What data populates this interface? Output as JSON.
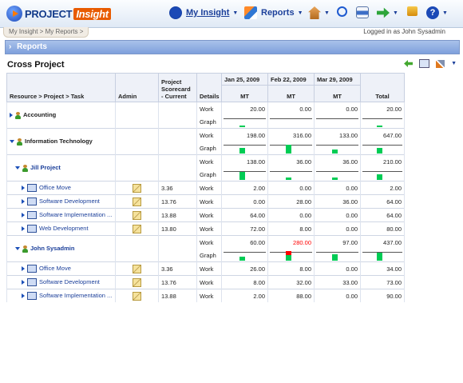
{
  "app": {
    "name_a": "PROJECT",
    "name_b": "Insight"
  },
  "toolbar": {
    "my_insight": "My Insight",
    "reports": "Reports"
  },
  "breadcrumb": "My Insight > My Reports >",
  "logged_in": "Logged in as John Sysadmin",
  "section": "Reports",
  "page_title": "Cross Project",
  "columns": {
    "resource": "Resource > Project > Task",
    "admin": "Admin",
    "scorecard": "Project Scorecard - Current",
    "details": "Details",
    "d1": "Jan 25, 2009",
    "d2": "Feb 22, 2009",
    "d3": "Mar 29, 2009",
    "mt": "MT",
    "total": "Total"
  },
  "rows": {
    "accounting": {
      "label": "Accounting",
      "work": [
        "20.00",
        "0.00",
        "0.00",
        "20.00"
      ],
      "graph": "Graph",
      "work_label": "Work"
    },
    "it": {
      "label": "Information Technology",
      "work": [
        "198.00",
        "316.00",
        "133.00",
        "647.00"
      ],
      "graph": "Graph",
      "work_label": "Work"
    },
    "jill": {
      "label": "Jill Project",
      "work": [
        "138.00",
        "36.00",
        "36.00",
        "210.00"
      ],
      "graph": "Graph",
      "work_label": "Work"
    },
    "t1": {
      "label": "Office Move",
      "score": "3.36",
      "work": [
        "2.00",
        "0.00",
        "0.00",
        "2.00"
      ],
      "work_label": "Work"
    },
    "t2": {
      "label": "Software Development",
      "score": "13.76",
      "work": [
        "0.00",
        "28.00",
        "36.00",
        "64.00"
      ],
      "work_label": "Work"
    },
    "t3": {
      "label": "Software Implementation ...",
      "score": "13.88",
      "work": [
        "64.00",
        "0.00",
        "0.00",
        "64.00"
      ],
      "work_label": "Work"
    },
    "t4": {
      "label": "Web Development",
      "score": "13.80",
      "work": [
        "72.00",
        "8.00",
        "0.00",
        "80.00"
      ],
      "work_label": "Work"
    },
    "john": {
      "label": "John Sysadmin",
      "work": [
        "60.00",
        "280.00",
        "97.00",
        "437.00"
      ],
      "graph": "Graph",
      "work_label": "Work"
    },
    "u1": {
      "label": "Office Move",
      "score": "3.36",
      "work": [
        "26.00",
        "8.00",
        "0.00",
        "34.00"
      ],
      "work_label": "Work"
    },
    "u2": {
      "label": "Software Development",
      "score": "13.76",
      "work": [
        "8.00",
        "32.00",
        "33.00",
        "73.00"
      ],
      "work_label": "Work"
    },
    "u3": {
      "label": "Software Implementation ...",
      "score": "13.88",
      "work": [
        "2.00",
        "88.00",
        "0.00",
        "90.00"
      ],
      "work_label": "Work"
    }
  },
  "graph_levels": {
    "accounting": [
      0.18,
      0,
      0,
      0.05
    ],
    "it": [
      0.6,
      0.95,
      0.4,
      0.55
    ],
    "jill": [
      0.85,
      0.25,
      0.25,
      0.55
    ],
    "john": [
      0.45,
      1.0,
      0.7,
      0.85
    ]
  },
  "colors": {
    "accent": "#1b3f9a",
    "bar": "#00cc55",
    "over": "#ff0000"
  }
}
